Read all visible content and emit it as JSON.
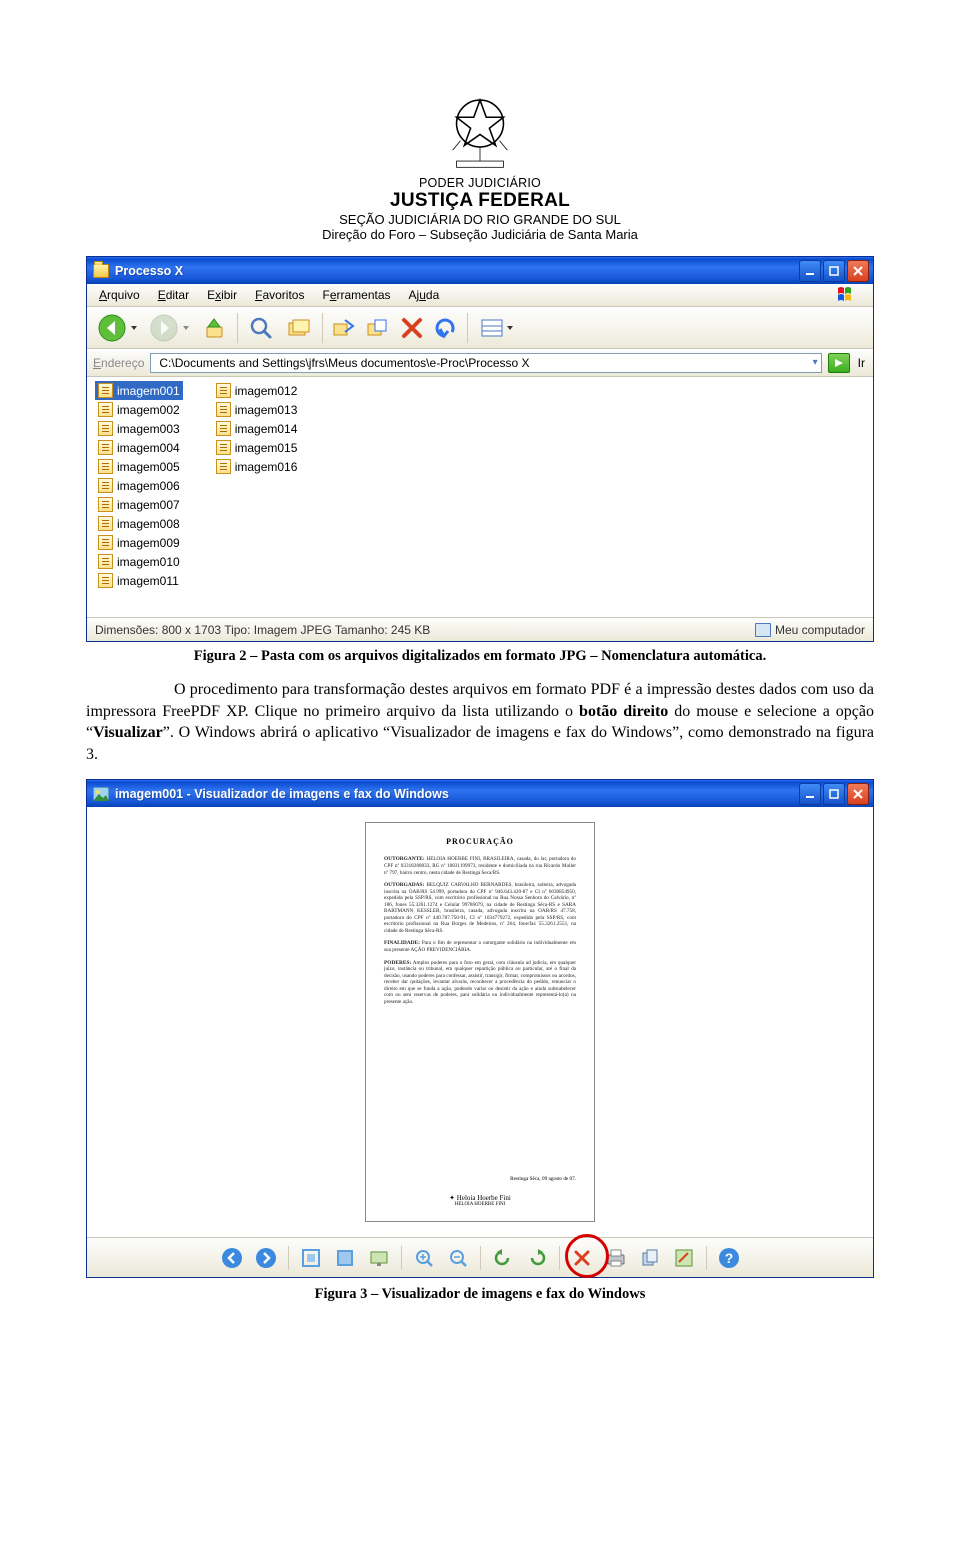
{
  "header": {
    "line1": "PODER JUDICIÁRIO",
    "line2": "JUSTIÇA FEDERAL",
    "line3": "SEÇÃO JUDICIÁRIA DO RIO GRANDE DO SUL",
    "line4": "Direção do Foro – Subseção Judiciária de Santa Maria"
  },
  "explorer": {
    "title": "Processo X",
    "menu": {
      "arquivo": "Arquivo",
      "editar": "Editar",
      "exibir": "Exibir",
      "favoritos": "Favoritos",
      "ferramentas": "Ferramentas",
      "ajuda": "Ajuda"
    },
    "addr_label": "Endereço",
    "path": "C:\\Documents and Settings\\jfrs\\Meus documentos\\e-Proc\\Processo X",
    "go_label": "Ir",
    "files_col1": [
      "imagem001",
      "imagem002",
      "imagem003",
      "imagem004",
      "imagem005",
      "imagem006",
      "imagem007",
      "imagem008",
      "imagem009",
      "imagem010",
      "imagem011"
    ],
    "files_col2": [
      "imagem012",
      "imagem013",
      "imagem014",
      "imagem015",
      "imagem016"
    ],
    "selected": "imagem001",
    "status_left": "Dimensões: 800 x 1703 Tipo: Imagem JPEG Tamanho: 245 KB",
    "status_right": "Meu computador"
  },
  "caption1": "Figura 2 – Pasta com os arquivos digitalizados em formato JPG – Nomenclatura automática.",
  "paragraph": {
    "p1a": "O procedimento para transformação destes arquivos em formato PDF é a impressão destes dados com uso da impressora FreePDF XP.   Clique no primeiro arquivo da lista utilizando o ",
    "p1b_bold": "botão direito",
    "p1c": " do mouse e selecione a opção “",
    "p1d_bold": "Visualizar",
    "p1e": "”.   O Windows abrirá o aplicativo “Visualizador de imagens e fax do Windows”, como demonstrado na figura 3."
  },
  "viewer": {
    "title": "imagem001 - Visualizador de imagens e fax do Windows",
    "doc_title": "PROCURAÇÃO",
    "doc_p1": "OUTORGANTE: HELOIA HOERBE FINI, BRASILEIRA, casada, do lar, portadora do CPF nº 03318288833, RG nº 10831199973, residente e domiciliada na rua Ricardo Muller nº 797, bairro centro, nesta cidade de Restinga Seca/RS.",
    "doc_p2": "OUTORGADAS: BELQUIZ CARVALHO BERNARDES, brasileira, solteira, advogada inscrita na OAB/RS 54.999, portadora do CPF nº 946.643.420-87 e CI nº 6030854950, expedida pela SSP/RS, com escritório profissional na Rua Nossa Senhora do Calvário, nº 186, fones 55.3261.1274 e Celular 99786079, na cidade de Restinga Sêca-RS e SARA BARTMANN KESSLER, brasileira, casada, advogada inscrita na OAB/RS 47.758, portadora do CPF nº 440.787.750-91, CI nº 1034779272, expedida pela SSP/RS, com escritório profissional na Rua Borges de Medeiros, nº 264, fone/fax 55.3261.2551, na cidade de Restinga Sêca-RS.",
    "doc_fin_label": "FINALIDADE:",
    "doc_fin": "Para o fim de representar o outorgante solidário na individualmente em sua presente AÇÃO PREVIDENCIÁRIA.",
    "doc_pod_label": "PODERES:",
    "doc_pod": "Amplos poderes para o foro em geral, com cláusula ad judicia, em qualquer juízo, instância ou tribunal, em qualquer repartição pública ou particular, até o final da decisão, usando poderes para confessar, assistir, transigir, firmar, compromissos ou acordos, receber dar quitações, levantar alvarás, reconhecer a procedência do pedido, renunciar o direito em que se funda a ação, podendo variar ou desistir da ação e ainda substabelecer com ou sem reservas de poderes, para solidária ou individualmente representá-lo(a) na presente ação.",
    "doc_place": "Restinga Sêca, 09 agosto de 07.",
    "doc_sig_name": "Heloia Hoerbe Fini",
    "doc_sig_under": "HELOIA HOERBE FINI"
  },
  "caption2": "Figura 3 – Visualizador de imagens e fax do Windows"
}
